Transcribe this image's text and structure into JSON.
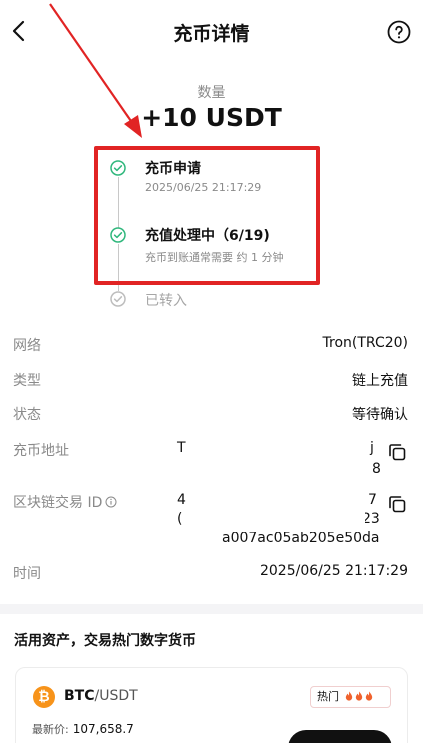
{
  "header": {
    "title": "充币详情"
  },
  "amount": {
    "label": "数量",
    "value": "+10 USDT"
  },
  "steps": [
    {
      "title": "充币申请",
      "subtitle": "2025/06/25 21:17:29",
      "state": "done"
    },
    {
      "title": "充值处理中（6/19)",
      "subtitle": "充币到账通常需要 约 1 分钟",
      "state": "current"
    },
    {
      "title": "已转入",
      "subtitle": "",
      "state": "pending"
    }
  ],
  "details": {
    "network": {
      "label": "网络",
      "value": "Tron(TRC20)"
    },
    "type": {
      "label": "类型",
      "value": "链上充值"
    },
    "status": {
      "label": "状态",
      "value": "等待确认"
    },
    "address": {
      "label": "充币地址",
      "line1_start": "T",
      "line1_end": "j",
      "line2_end": "8"
    },
    "txid": {
      "label": "区块链交易 ID",
      "line1_start": "4",
      "line1_end": "7",
      "line2_start": "(",
      "line2_end": "23",
      "line3": "a007ac05ab205e50da"
    },
    "time": {
      "label": "时间",
      "value": "2025/06/25 21:17:29"
    }
  },
  "promo": {
    "title": "活用资产，交易热门数字货币",
    "card": {
      "base": "BTC",
      "quote": "/USDT",
      "hot_label": "热门",
      "latest_label": "最新价:",
      "latest_value": "107,658.7"
    }
  },
  "colors": {
    "accent_green": "#2fb77c",
    "highlight_red": "#e12424",
    "btc_orange": "#f7931a"
  },
  "icons": [
    "back-arrow-icon",
    "help-circle-icon",
    "check-circle-icon",
    "copy-icon",
    "info-icon",
    "bitcoin-icon",
    "flame-icon"
  ]
}
